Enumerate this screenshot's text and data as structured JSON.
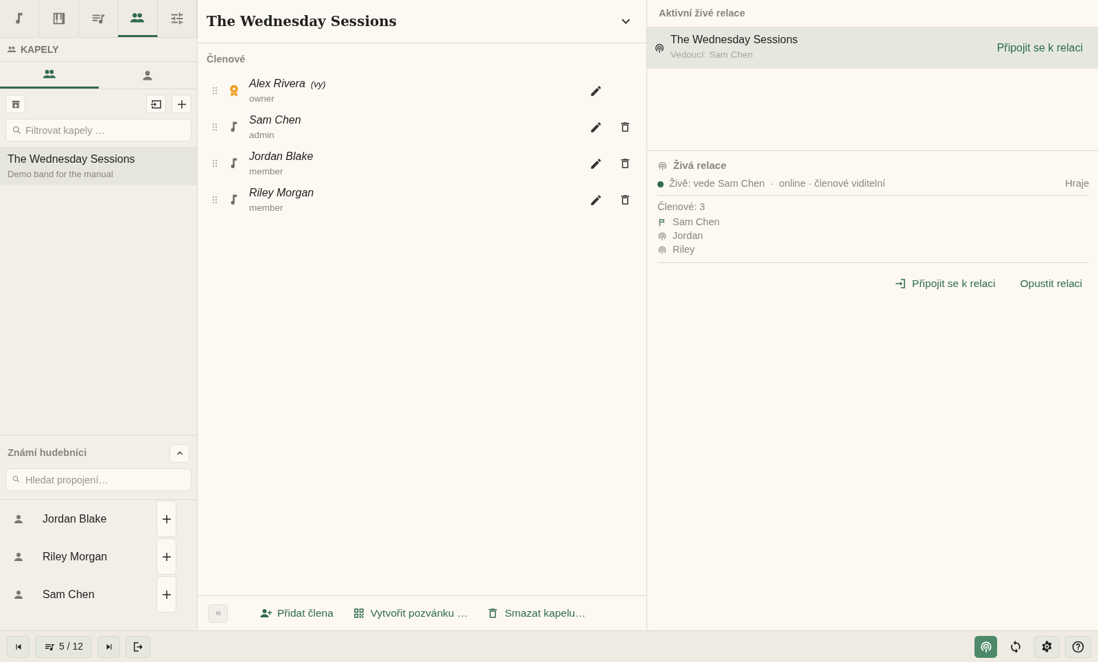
{
  "nav_tabs": [
    {
      "kind": "note",
      "selected": false
    },
    {
      "kind": "piano",
      "selected": false
    },
    {
      "kind": "queue",
      "selected": false
    },
    {
      "kind": "group",
      "selected": true
    },
    {
      "kind": "tune",
      "selected": false
    }
  ],
  "sidebar": {
    "section_title": "KAPELY",
    "sub_tabs": [
      {
        "kind": "group",
        "selected": true
      },
      {
        "kind": "person",
        "selected": false
      }
    ],
    "filter": {
      "placeholder": "Filtrovat kapely …"
    },
    "bands": [
      {
        "name": "The Wednesday Sessions",
        "description": "Demo band for the manual",
        "selected": true
      }
    ],
    "known_musicians": {
      "title": "Známí hudebníci",
      "expanded": true,
      "search": {
        "placeholder": "Hledat propojení…"
      },
      "items": [
        {
          "name": "Jordan Blake"
        },
        {
          "name": "Riley Morgan"
        },
        {
          "name": "Sam Chen"
        }
      ]
    }
  },
  "band": {
    "title": "The Wednesday Sessions",
    "members_label": "Členové",
    "members": [
      {
        "name": "Alex Rivera",
        "note": "(vy)",
        "role": "owner",
        "kind": "owner",
        "deletable": false
      },
      {
        "name": "Sam Chen",
        "role": "admin",
        "kind": "musician",
        "deletable": true
      },
      {
        "name": "Jordan Blake",
        "role": "member",
        "kind": "musician",
        "deletable": true
      },
      {
        "name": "Riley Morgan",
        "role": "member",
        "kind": "musician",
        "deletable": true
      }
    ],
    "actions": [
      {
        "kind": "add",
        "label": "Přidat člena"
      },
      {
        "kind": "invite",
        "label": "Vytvořit pozvánku …"
      },
      {
        "kind": "delete",
        "label": "Smazat kapelu…"
      }
    ]
  },
  "sessions": {
    "title": "Aktivní živé relace",
    "items": [
      {
        "name": "The Wednesday Sessions",
        "leader": "Vedoucí: Sam Chen",
        "action": "Připojit se k relaci",
        "selected": true
      }
    ]
  },
  "live_session": {
    "title": "Živá relace",
    "live": true,
    "status": "Živě: vede Sam Chen",
    "separator": "·",
    "detail": "online · členové viditelní",
    "state": "Hraje",
    "members_count": "Členové: 3",
    "members": [
      {
        "name": "Sam Chen",
        "kind": "leader"
      },
      {
        "name": "Jordan",
        "kind": "listener"
      },
      {
        "name": "Riley",
        "kind": "listener"
      }
    ],
    "join": "Připojit se k relaci",
    "leave": "Opustit relaci"
  },
  "bottom_bar": {
    "position": "5 / 12",
    "broadcast_on": true
  }
}
